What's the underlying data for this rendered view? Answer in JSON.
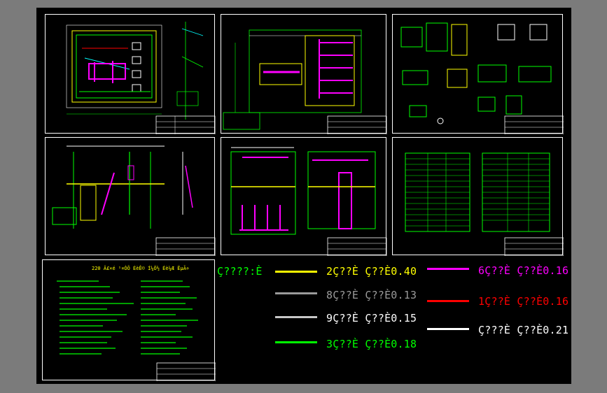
{
  "colors": {
    "background": "#000000",
    "outer": "#7b7b7b",
    "yellow": "#ffff00",
    "gray8": "#9a9a9a",
    "gray9": "#c8c8c8",
    "green": "#00ff00",
    "magenta": "#ff00ff",
    "red": "#ff0000",
    "white": "#ffffff",
    "cyan": "#00ffff"
  },
  "legend": {
    "title": "Ç????:È",
    "items": [
      {
        "label": "2Ç??È Ç??È0.40",
        "color": "#ffff00"
      },
      {
        "label": "8Ç??È Ç??È0.13",
        "color": "#9a9a9a"
      },
      {
        "label": "9Ç??È Ç??È0.15",
        "color": "#c8c8c8"
      },
      {
        "label": "3Ç??È Ç??È0.18",
        "color": "#00ff00"
      },
      {
        "label": "6Ç??È Ç??È0.16",
        "color": "#ff00ff"
      },
      {
        "label": "1Ç??È Ç??È0.16",
        "color": "#ff0000"
      },
      {
        "label": "Ç???È Ç??È0.21",
        "color": "#ffffff"
      }
    ]
  },
  "notes_sheet": {
    "heading": "220 Ä£×é ¹¤ÒÕ ÉèÊ© Í¼Ö½ Éè¼Æ ËµÃ÷"
  }
}
